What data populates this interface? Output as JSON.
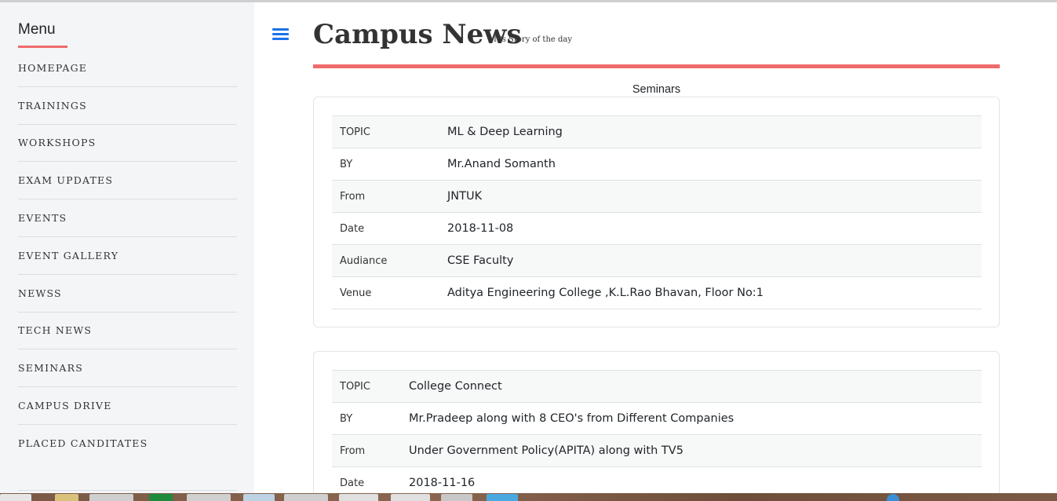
{
  "sidebar": {
    "title": "Menu",
    "items": [
      {
        "label": "HOMEPAGE"
      },
      {
        "label": "TRAININGS"
      },
      {
        "label": "WORKSHOPS"
      },
      {
        "label": "EXAM UPDATES"
      },
      {
        "label": "EVENTS"
      },
      {
        "label": "EVENT GALLERY"
      },
      {
        "label": "NEWSS"
      },
      {
        "label": "TECH NEWS"
      },
      {
        "label": "SEMINARS"
      },
      {
        "label": "CAMPUS DRIVE"
      },
      {
        "label": "PLACED CANDITATES"
      }
    ]
  },
  "header": {
    "title": "Campus News",
    "subtitle": "It's Story of the day"
  },
  "section": {
    "heading": "Seminars"
  },
  "seminars": [
    {
      "rows": [
        {
          "key": "TOPIC",
          "value": "ML & Deep Learning"
        },
        {
          "key": "BY",
          "value": "Mr.Anand Somanth"
        },
        {
          "key": "From",
          "value": "JNTUK"
        },
        {
          "key": "Date",
          "value": "2018-11-08"
        },
        {
          "key": "Audiance",
          "value": "CSE Faculty"
        },
        {
          "key": "Venue",
          "value": "Aditya Engineering College ,K.L.Rao Bhavan, Floor No:1"
        }
      ]
    },
    {
      "rows": [
        {
          "key": "TOPIC",
          "value": "College Connect"
        },
        {
          "key": "BY",
          "value": "Mr.Pradeep along with 8 CEO's from Different Companies"
        },
        {
          "key": "From",
          "value": "Under Government Policy(APITA) along with TV5"
        },
        {
          "key": "Date",
          "value": "2018-11-16"
        }
      ]
    }
  ],
  "colors": {
    "accent": "#f06b6b",
    "menu_icon": "#1a73e8",
    "sidebar_bg": "#f4f5f7",
    "stripe": "#f7f8f8"
  },
  "icons": {
    "menu": "hamburger-menu-icon"
  }
}
